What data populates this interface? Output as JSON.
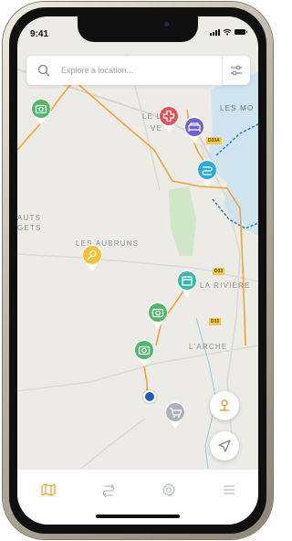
{
  "status": {
    "time": "9:41"
  },
  "search": {
    "placeholder": "Explore a location..."
  },
  "map_labels": {
    "le_lin": "LE LIN",
    "vet": "VE",
    "les_mo": "LES MO",
    "auts": "AUTS",
    "gets": "GETS",
    "les_aubruns": "LES AUBRUNS",
    "la_riviere": "LA RIVIÈRE",
    "l_arche": "L'ARCHE",
    "road_d33a": "D33A",
    "road_d33": "D33",
    "road_d33b": "D33"
  },
  "pins": [
    {
      "name": "camera",
      "color": "#4fb66b"
    },
    {
      "name": "medical",
      "color": "#e0505a"
    },
    {
      "name": "bed",
      "color": "#6f63c9"
    },
    {
      "name": "route",
      "color": "#2ea9de"
    },
    {
      "name": "flower",
      "color": "#f2c13a"
    },
    {
      "name": "calendar",
      "color": "#39b7a8"
    },
    {
      "name": "cart",
      "color": "#b8bcc2"
    }
  ],
  "colors": {
    "route": "#f5a23a",
    "water": "#cde3ef",
    "border": "#2b7bc0",
    "accent": "#f0a43a",
    "tab_inactive": "#b8bcc2"
  },
  "tabs": [
    {
      "name": "map",
      "active": true
    },
    {
      "name": "routes",
      "active": false
    },
    {
      "name": "settings",
      "active": false
    },
    {
      "name": "menu",
      "active": false
    }
  ]
}
